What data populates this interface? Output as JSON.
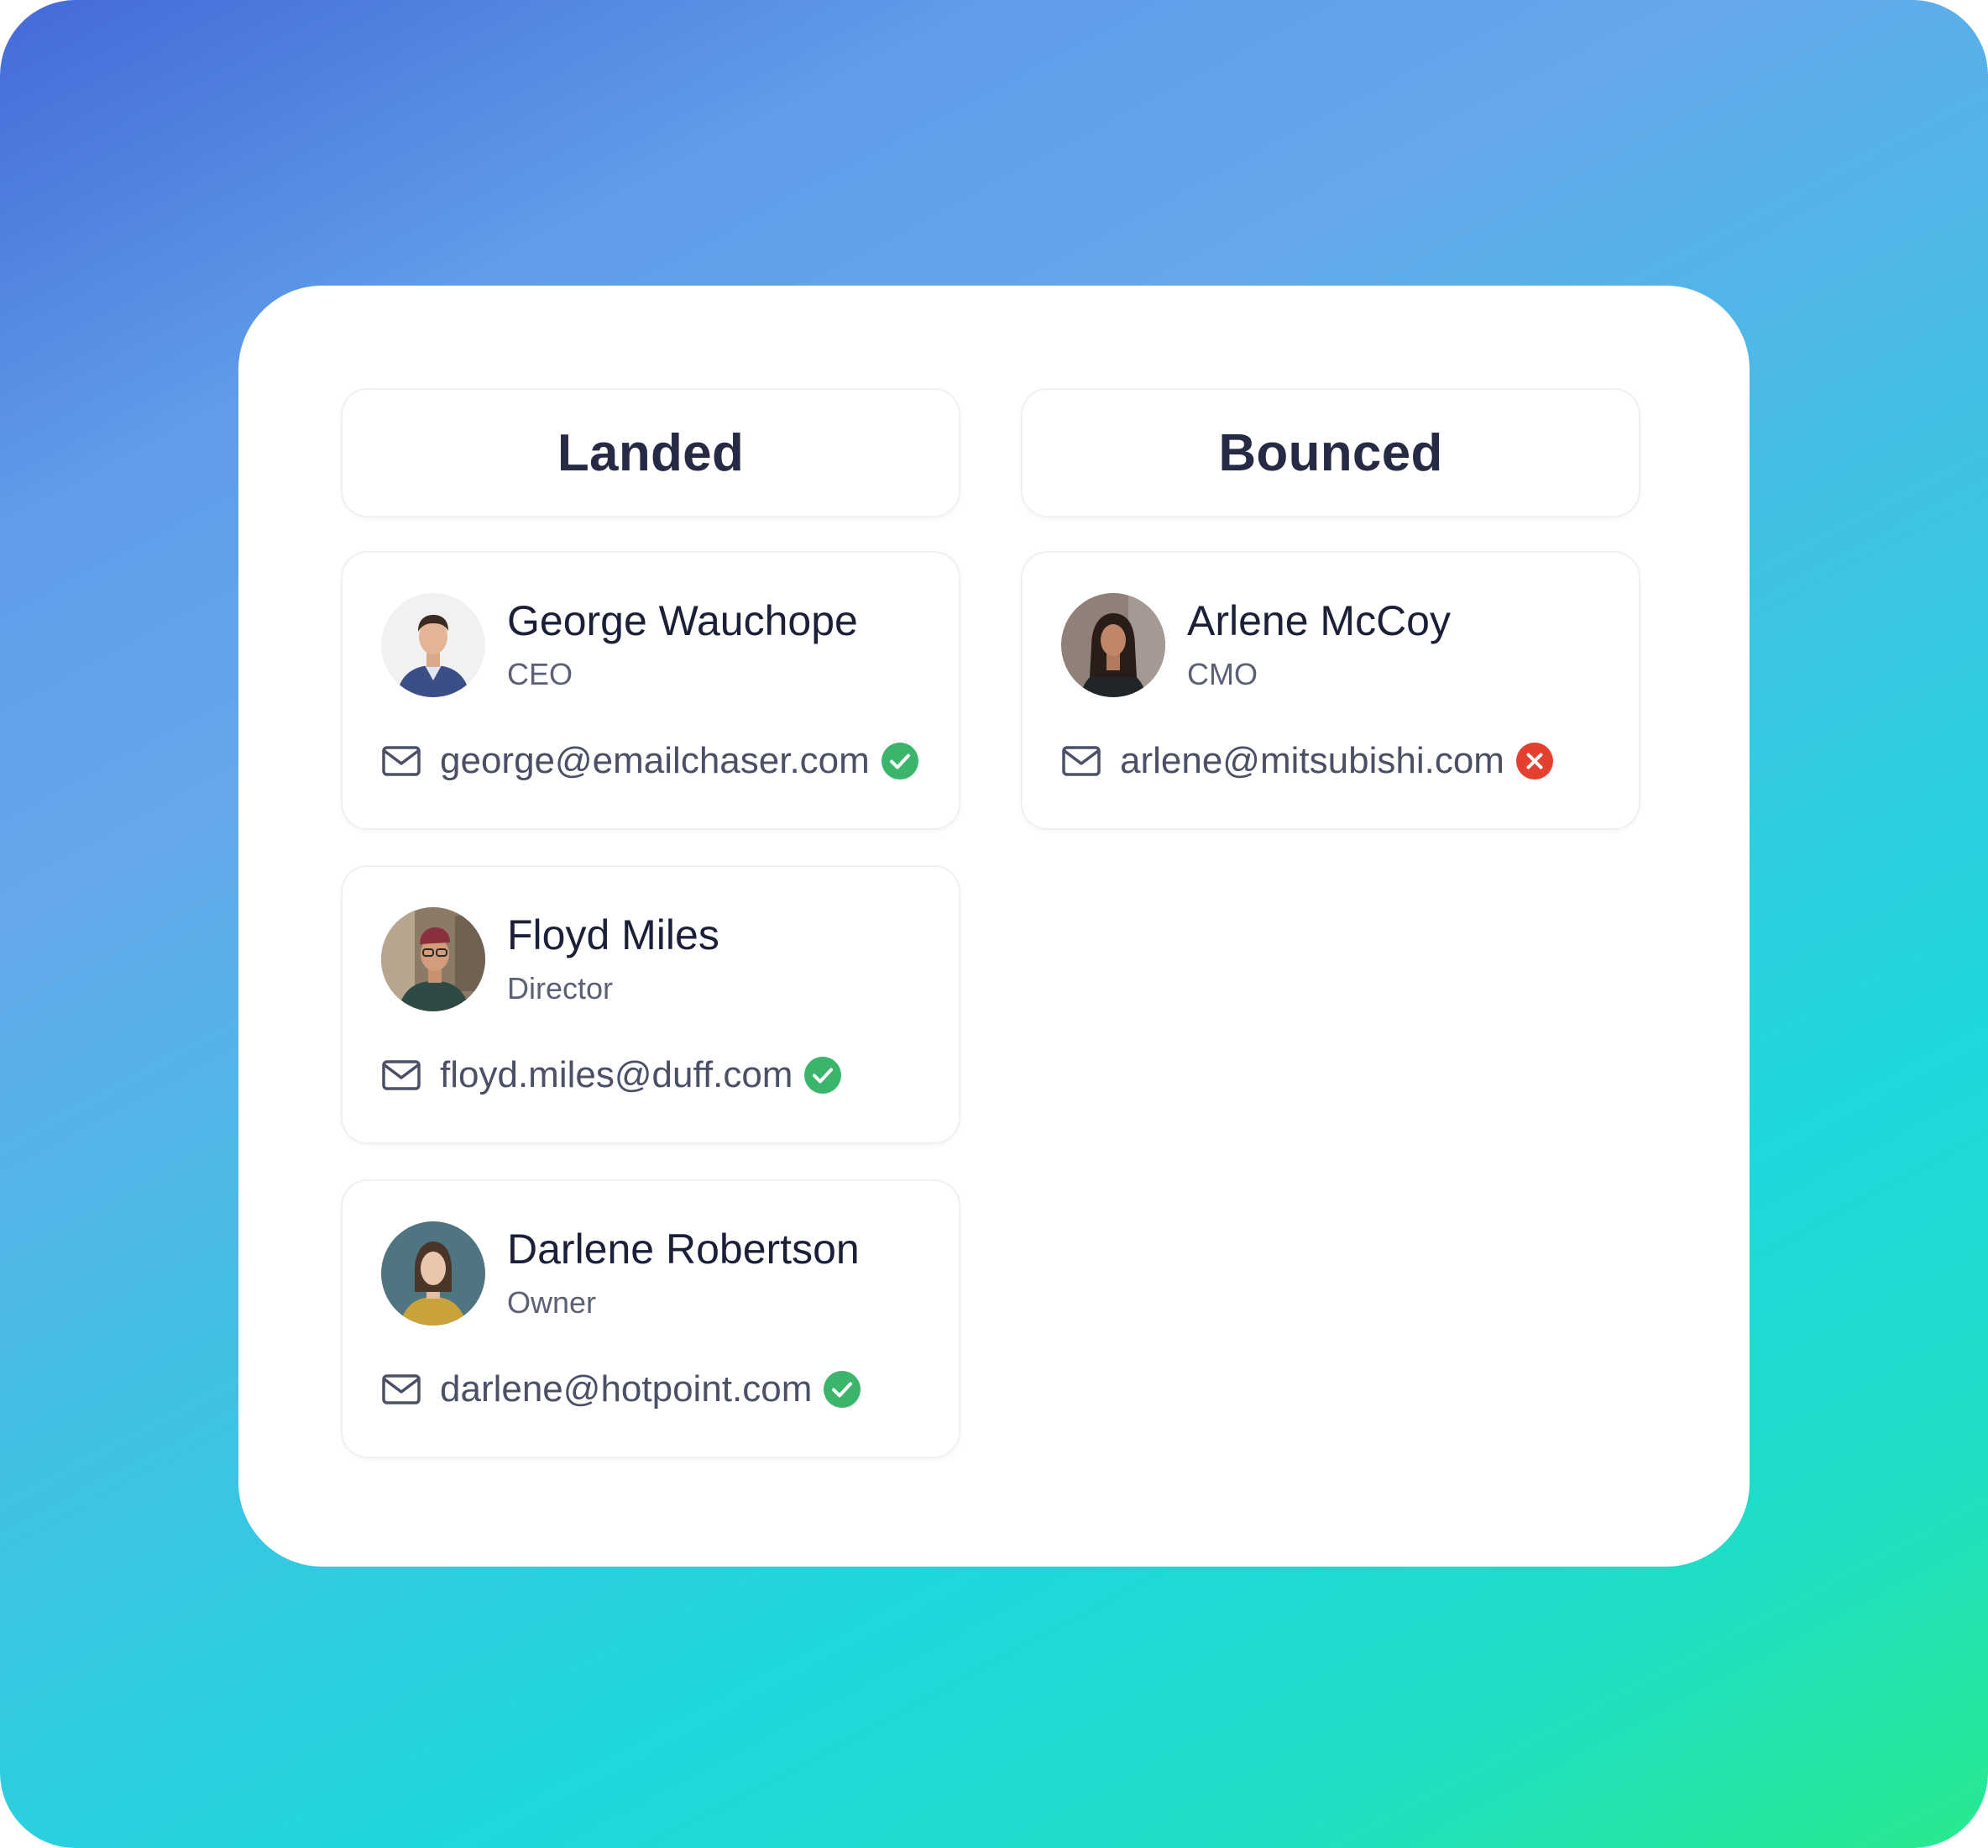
{
  "columns": [
    {
      "title": "Landed",
      "contacts": [
        {
          "name": "George Wauchope",
          "role": "CEO",
          "email": "george@emailchaser.com",
          "status": "landed"
        },
        {
          "name": "Floyd Miles",
          "role": "Director",
          "email": "floyd.miles@duff.com",
          "status": "landed"
        },
        {
          "name": "Darlene Robertson",
          "role": "Owner",
          "email": "darlene@hotpoint.com",
          "status": "landed"
        }
      ]
    },
    {
      "title": "Bounced",
      "contacts": [
        {
          "name": "Arlene McCoy",
          "role": "CMO",
          "email": "arlene@mitsubishi.com",
          "status": "bounced"
        }
      ]
    }
  ],
  "icons": {
    "email": "mail-icon",
    "landed": "check-circle-icon",
    "bounced": "x-circle-icon"
  },
  "colors": {
    "success": "#3bb56c",
    "error": "#e5402f",
    "heading": "#262a44",
    "gradient_start": "#4569d8",
    "gradient_end": "#27ea8c"
  }
}
